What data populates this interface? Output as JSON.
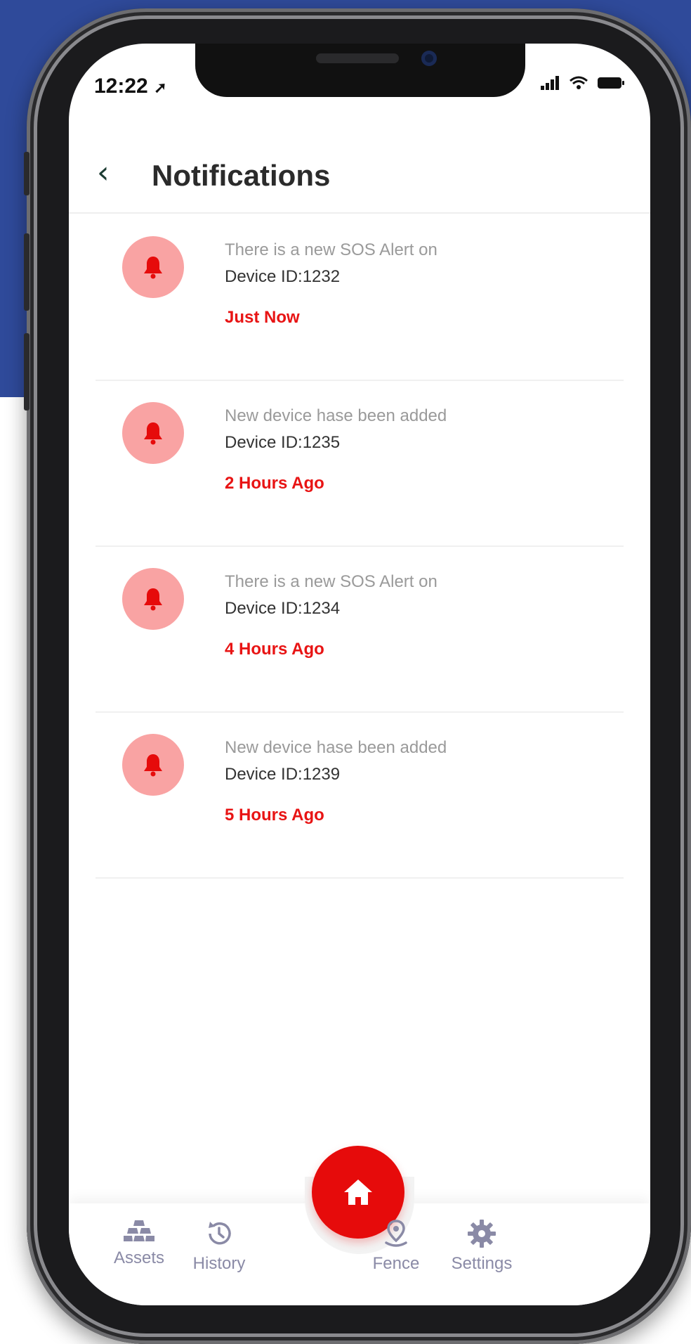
{
  "status_bar": {
    "time": "12:22"
  },
  "header": {
    "title": "Notifications",
    "back_icon": "chevron-left-icon"
  },
  "notifications": [
    {
      "message": "There is a new SOS Alert on",
      "device": "Device ID:1232",
      "time": "Just Now"
    },
    {
      "message": "New device hase been added",
      "device": "Device ID:1235",
      "time": "2 Hours Ago"
    },
    {
      "message": "There is a new SOS Alert on",
      "device": "Device ID:1234",
      "time": "4 Hours Ago"
    },
    {
      "message": "New device hase been added",
      "device": "Device ID:1239",
      "time": "5 Hours Ago"
    }
  ],
  "tabbar": {
    "assets": "Assets",
    "history": "History",
    "fence": "Fence",
    "settings": "Settings",
    "home_icon": "home-icon"
  },
  "colors": {
    "accent_red": "#e60b0b",
    "bell_bg": "#f9a3a3",
    "background_blue": "#2f4a9a",
    "tab_label": "#8a8aa6"
  }
}
